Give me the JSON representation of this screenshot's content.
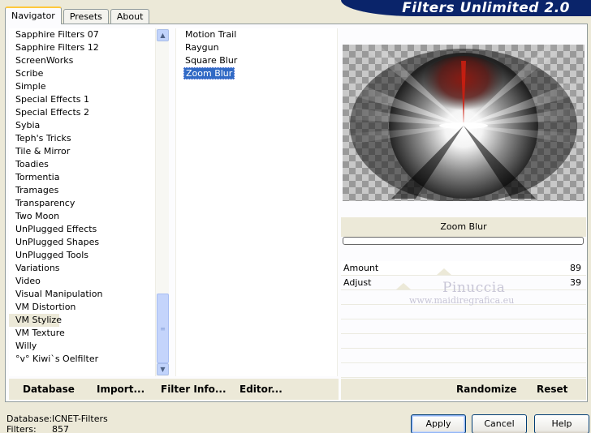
{
  "tabs": [
    "Navigator",
    "Presets",
    "About"
  ],
  "title": "Filters Unlimited 2.0",
  "categories": [
    "Sapphire Filters 07",
    "Sapphire Filters 12",
    "ScreenWorks",
    "Scribe",
    "Simple",
    "Special Effects 1",
    "Special Effects 2",
    "Sybia",
    "Teph's Tricks",
    "Tile & Mirror",
    "Toadies",
    "Tormentia",
    "Tramages",
    "Transparency",
    "Two Moon",
    "UnPlugged Effects",
    "UnPlugged Shapes",
    "UnPlugged Tools",
    "Variations",
    "Video",
    "Visual Manipulation",
    "VM Distortion",
    "VM Stylize",
    "VM Texture",
    "Willy",
    "°v° Kiwi`s Oelfilter"
  ],
  "selected_category": "VM Stylize",
  "filters": [
    "Motion Trail",
    "Raygun",
    "Square Blur",
    "Zoom Blur"
  ],
  "selected_filter": "Zoom Blur",
  "filter_name": "Zoom Blur",
  "params": [
    {
      "label": "Amount",
      "value": "89",
      "level": 0.35
    },
    {
      "label": "Adjust",
      "value": "39",
      "level": 0.15
    }
  ],
  "watermark": {
    "line1": "Pinuccia",
    "line2": "www.maidiregrafica.eu"
  },
  "left_buttons": {
    "database": "Database",
    "import": "Import...",
    "filter_info": "Filter Info...",
    "editor": "Editor..."
  },
  "right_buttons": {
    "randomize": "Randomize",
    "reset": "Reset"
  },
  "status": {
    "database_label": "Database:",
    "database_value": "ICNET-Filters",
    "filters_label": "Filters:",
    "filters_value": "857"
  },
  "dialog_buttons": {
    "apply": "Apply",
    "cancel": "Cancel",
    "help": "Help"
  },
  "colors": {
    "selection": "#316ac5",
    "title_banner": "#0a246a",
    "face": "#ece9d8"
  }
}
